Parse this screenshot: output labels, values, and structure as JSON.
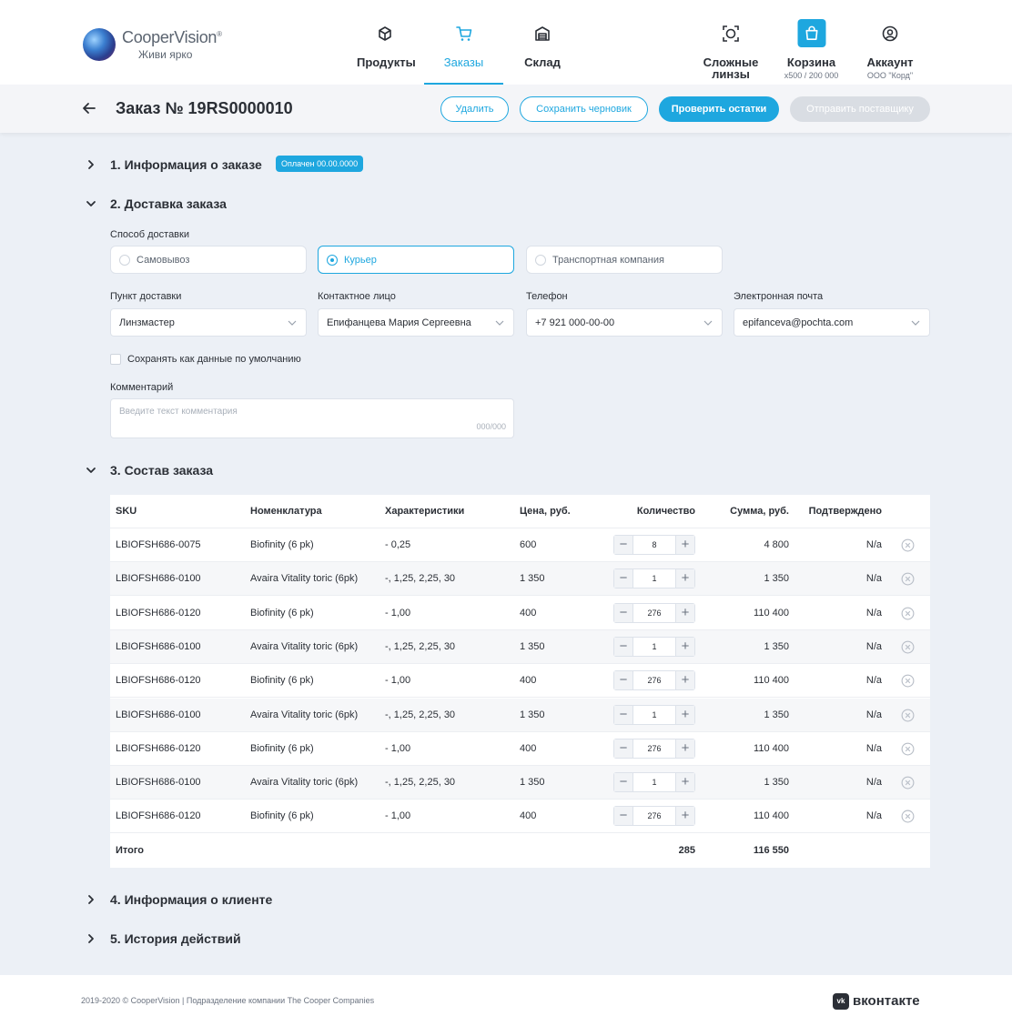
{
  "brand": {
    "name": "CooperVision",
    "reg": "®",
    "slogan": "Живи ярко"
  },
  "nav": [
    {
      "label": "Продукты",
      "icon": "box-icon"
    },
    {
      "label": "Заказы",
      "icon": "cart-icon",
      "active": true
    },
    {
      "label": "Склад",
      "icon": "warehouse-icon"
    }
  ],
  "nav_right": {
    "complex": {
      "label_line1": "Сложные",
      "label_line2": "линзы",
      "icon": "complex-lens-icon"
    },
    "cart": {
      "label": "Корзина",
      "sub": "x500 / 200 000",
      "icon": "bag-icon"
    },
    "account": {
      "label": "Аккаунт",
      "sub": "ООО \"Корд\"",
      "icon": "user-circle-icon"
    }
  },
  "toolbar": {
    "title": "Заказ № 19RS0000010",
    "delete_label": "Удалить",
    "save_draft_label": "Сохранить черновик",
    "check_stock_label": "Проверить остатки",
    "send_label": "Отправить поставщику"
  },
  "sections": {
    "s1": {
      "title": "1. Информация о заказе",
      "badge": "Оплачен 00.00.0000"
    },
    "s2": {
      "title": "2. Доставка заказа"
    },
    "s3": {
      "title": "3. Состав заказа"
    },
    "s4": {
      "title": "4. Информация о клиенте"
    },
    "s5": {
      "title": "5. История действий"
    }
  },
  "delivery": {
    "method_label": "Способ доставки",
    "methods": [
      "Самовывоз",
      "Курьер",
      "Транспортная компания"
    ],
    "selected": "Курьер",
    "point_label": "Пункт доставки",
    "point_value": "Линзмастер",
    "contact_label": "Контактное лицо",
    "contact_value": "Епифанцева Мария Сергеевна",
    "phone_label": "Телефон",
    "phone_value": "+7 921 000-00-00",
    "email_label": "Электронная почта",
    "email_value": "epifanceva@pochta.com",
    "default_label": "Сохранять как данные по умолчанию",
    "comment_label": "Комментарий",
    "comment_placeholder": "Введите текст комментария",
    "comment_counter": "000/000"
  },
  "table": {
    "headers": {
      "sku": "SKU",
      "name": "Номенклатура",
      "chars": "Характеристики",
      "price": "Цена, руб.",
      "qty": "Количество",
      "sum": "Сумма, руб.",
      "confirmed": "Подтверждено"
    },
    "rows": [
      {
        "sku": "LBIOFSH686-0075",
        "name": "Biofinity (6 pk)",
        "chars": "- 0,25",
        "price": "600",
        "qty": "8",
        "sum": "4  800",
        "confirmed": "N/a"
      },
      {
        "sku": "LBIOFSH686-0100",
        "name": "Avaira Vitality toric (6pk)",
        "chars": "-, 1,25, 2,25, 30",
        "price": "1 350",
        "qty": "1",
        "sum": "1 350",
        "confirmed": "N/a"
      },
      {
        "sku": "LBIOFSH686-0120",
        "name": "Biofinity (6 pk)",
        "chars": "- 1,00",
        "price": "400",
        "qty": "276",
        "sum": "110 400",
        "confirmed": "N/a"
      },
      {
        "sku": "LBIOFSH686-0100",
        "name": "Avaira Vitality toric (6pk)",
        "chars": "-, 1,25, 2,25, 30",
        "price": "1 350",
        "qty": "1",
        "sum": "1 350",
        "confirmed": "N/a"
      },
      {
        "sku": "LBIOFSH686-0120",
        "name": "Biofinity (6 pk)",
        "chars": "- 1,00",
        "price": "400",
        "qty": "276",
        "sum": "110 400",
        "confirmed": "N/a"
      },
      {
        "sku": "LBIOFSH686-0100",
        "name": "Avaira Vitality toric (6pk)",
        "chars": "-, 1,25, 2,25, 30",
        "price": "1 350",
        "qty": "1",
        "sum": "1 350",
        "confirmed": "N/a"
      },
      {
        "sku": "LBIOFSH686-0120",
        "name": "Biofinity (6 pk)",
        "chars": "- 1,00",
        "price": "400",
        "qty": "276",
        "sum": "110 400",
        "confirmed": "N/a"
      },
      {
        "sku": "LBIOFSH686-0100",
        "name": "Avaira Vitality toric (6pk)",
        "chars": "-, 1,25, 2,25, 30",
        "price": "1 350",
        "qty": "1",
        "sum": "1 350",
        "confirmed": "N/a"
      },
      {
        "sku": "LBIOFSH686-0120",
        "name": "Biofinity (6 pk)",
        "chars": "- 1,00",
        "price": "400",
        "qty": "276",
        "sum": "110 400",
        "confirmed": "N/a"
      }
    ],
    "total_label": "Итого",
    "total_qty": "285",
    "total_sum": "116 550"
  },
  "footer": {
    "copyright": "2019-2020 © CooperVision | Подразделение компании The Cooper Companies",
    "vk_logo": "vk",
    "vk_text": "вконтакте"
  },
  "colors": {
    "accent": "#1ea7df",
    "background": "#ecf0f6",
    "text": "#2b2f36"
  }
}
